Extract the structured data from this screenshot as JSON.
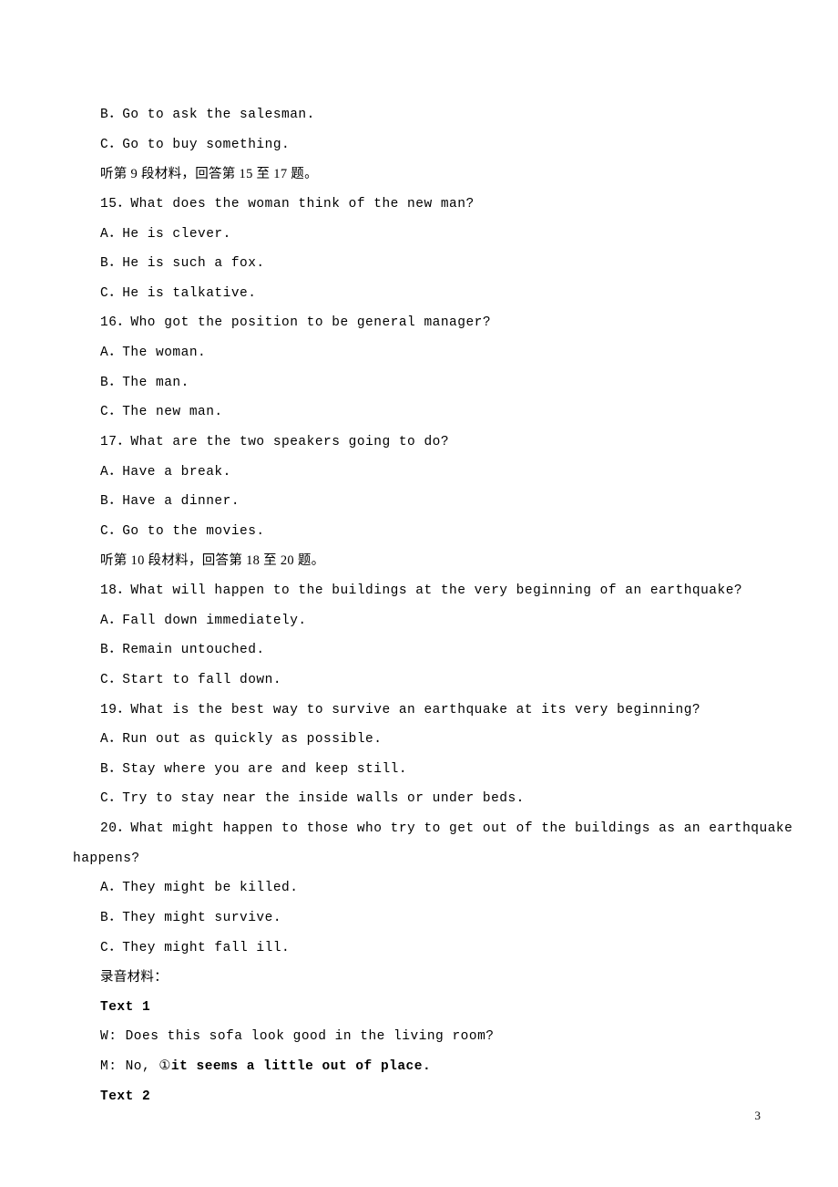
{
  "lines": {
    "l1": "B．Go to ask the salesman.",
    "l2": "C．Go to buy something.",
    "l3": "听第 9 段材料，回答第 15 至 17 题。",
    "l4": "15．What does the woman think of the new man?",
    "l5": "A．He is clever.",
    "l6": "B．He is such a fox.",
    "l7": "C．He is talkative.",
    "l8": "16．Who got the position to be general manager?",
    "l9": "A．The woman.",
    "l10": "B．The man.",
    "l11": "C．The new man.",
    "l12": "17．What are the two speakers going to do?",
    "l13": "A．Have a break.",
    "l14": "B．Have a dinner.",
    "l15": "C．Go to the movies.",
    "l16": "听第 10 段材料，回答第 18 至 20 题。",
    "l17": "18．What will happen to the buildings at the very beginning of an earthquake?",
    "l18": "A．Fall down immediately.",
    "l19": "B．Remain untouched.",
    "l20": "C．Start to fall down.",
    "l21": "19．What is the best way to survive an earthquake at its very beginning?",
    "l22": "A．Run out as quickly as possible.",
    "l23": "B．Stay where you are and keep still.",
    "l24": "C．Try to stay near the inside walls or under beds.",
    "l25_prefix": "20．",
    "l25_rest": "What might happen to those who try to get out of the buildings as an earthquake",
    "l26": "happens?",
    "l27": "A．They might be killed.",
    "l28": "B．They might survive.",
    "l29": "C．They might fall ill.",
    "l30": "录音材料：",
    "l31": "Text 1",
    "l32": "W: Does this sofa look good in the living room?",
    "l33_prefix": "M: No, ",
    "l33_circle": "①",
    "l33_bold": "it seems a little out of place.",
    "l34": "Text 2"
  },
  "page_number": "3"
}
